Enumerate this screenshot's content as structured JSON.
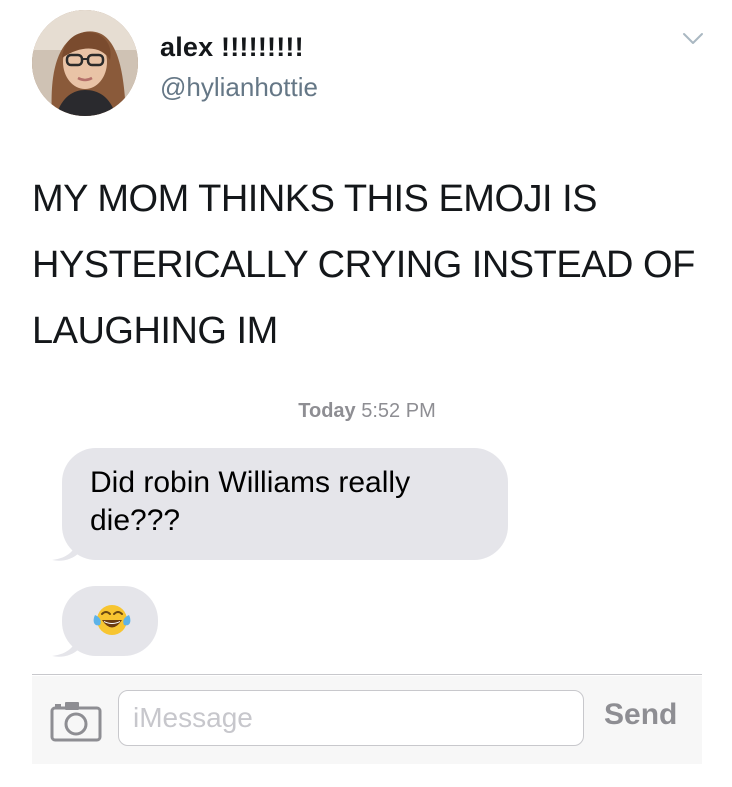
{
  "tweet": {
    "display_name": "alex !!!!!!!!!",
    "handle": "@hylianhottie",
    "text": "MY MOM THINKS THIS EMOJI IS HYSTERICALLY CRYING INSTEAD OF LAUGHING IM",
    "menu_icon": "chevron-down-icon",
    "avatar_icon": "profile-photo"
  },
  "conversation": {
    "timestamp_day": "Today",
    "timestamp_time": "5:52 PM",
    "messages": [
      {
        "from": "mom",
        "text": "Did robin Williams really die???"
      },
      {
        "from": "mom",
        "emoji": "face-with-tears-of-joy"
      }
    ]
  },
  "composer": {
    "camera_icon": "camera-icon",
    "placeholder": "iMessage",
    "send_label": "Send"
  },
  "colors": {
    "bubble": "#e5e5ea",
    "handle": "#657786",
    "timestamp": "#8e8e93",
    "send_disabled": "#8e8e93"
  }
}
